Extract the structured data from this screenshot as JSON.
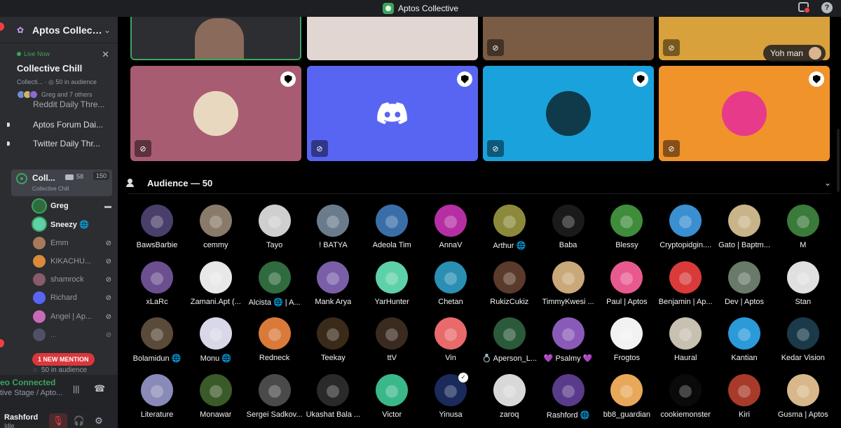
{
  "window": {
    "title": "Aptos Collective"
  },
  "sidebar": {
    "server_name": "Aptos Collecti...",
    "live": {
      "status": "Live Now",
      "title": "Collective Chill",
      "subtitle": "Collecti... · ◎ 50 in audience",
      "people_text": "Greg and 7 others"
    },
    "channels": [
      "Reddit Daily Thre...",
      "Aptos Forum Dai...",
      "Twitter Daily Thr..."
    ],
    "stage": {
      "name": "Coll...",
      "sub": "Collective Chill",
      "video_count": "58",
      "limit": "150"
    },
    "members": [
      {
        "name": "Greg",
        "state": "camera"
      },
      {
        "name": "Sneezy 🌐",
        "state": "none"
      },
      {
        "name": "Emm",
        "state": "muted"
      },
      {
        "name": "KIKACHU...",
        "state": "muted"
      },
      {
        "name": "shamrock",
        "state": "muted"
      },
      {
        "name": "Richard",
        "state": "muted"
      },
      {
        "name": "Angel | Ap...",
        "state": "muted"
      },
      {
        "name": "...",
        "state": "muted"
      }
    ],
    "mention_badge": "1 NEW MENTION",
    "audience_count": "50 in audience",
    "voice": {
      "status": "eo Connected",
      "channel": "tive Stage / Apto..."
    },
    "user": {
      "name": "Rashford",
      "status": "Idle"
    }
  },
  "stage_tiles": {
    "bottom_row_colors": [
      "#a85c72",
      "#5865f2",
      "#1aa2dc",
      "#f0932b"
    ],
    "top_row_colors": [
      "#2d2e31",
      "#e2d6d2",
      "#7a5c45",
      "#d9a13b"
    ],
    "speaker_tag": "Yoh man"
  },
  "audience": {
    "title": "Audience — 50",
    "people": [
      {
        "name": "BawsBarbie",
        "color": "#4a3f6b"
      },
      {
        "name": "cemmy",
        "color": "#8a7a6a"
      },
      {
        "name": "Tayo",
        "color": "#cfcfcf"
      },
      {
        "name": "! BATYA",
        "color": "#6a7c8c"
      },
      {
        "name": "Adeola Tim",
        "color": "#3a6ea8"
      },
      {
        "name": "AnnaV",
        "color": "#b52fa3"
      },
      {
        "name": "Arthur 🌐",
        "color": "#8b8a3c"
      },
      {
        "name": "Baba",
        "color": "#1a1a1a"
      },
      {
        "name": "Blessy",
        "color": "#3f8d3a"
      },
      {
        "name": "Cryptopidgin....",
        "color": "#3a8fd1"
      },
      {
        "name": "Gato | Baptm...",
        "color": "#c9b48a"
      },
      {
        "name": "M",
        "color": "#3a7a3a"
      },
      {
        "name": "xLaRc",
        "color": "#6b4f8f"
      },
      {
        "name": "Zamani.Apt (...",
        "color": "#e8e8e8"
      },
      {
        "name": "Alcista 🌐 | A...",
        "color": "#2f6b3f"
      },
      {
        "name": "Mank Arya",
        "color": "#7a5fa8"
      },
      {
        "name": "YarHunter",
        "color": "#5fd1a8"
      },
      {
        "name": "Chetan",
        "color": "#2a8fb3"
      },
      {
        "name": "RukizCukiz",
        "color": "#5a3a2a"
      },
      {
        "name": "TimmyKwesi ...",
        "color": "#c9a87a"
      },
      {
        "name": "Paul | Aptos",
        "color": "#e85a8f"
      },
      {
        "name": "Benjamin | Ap...",
        "color": "#d93a3a"
      },
      {
        "name": "Dev | Aptos",
        "color": "#6a7a6a"
      },
      {
        "name": "Stan",
        "color": "#e0e0e0"
      },
      {
        "name": "Bolamidun 🌐",
        "color": "#5a4a3a"
      },
      {
        "name": "Monu 🌐",
        "color": "#d8d8e8"
      },
      {
        "name": "Redneck",
        "color": "#d97a3a"
      },
      {
        "name": "Teekay",
        "color": "#3a2a1a"
      },
      {
        "name": "ttV",
        "color": "#3a2a1f"
      },
      {
        "name": "Vin",
        "color": "#e86a6a"
      },
      {
        "name": "💍 Aperson_L...",
        "color": "#2a5a3a"
      },
      {
        "name": "💜 Psalmy 💜",
        "color": "#8a5ab8"
      },
      {
        "name": "Frogtos",
        "color": "#f2f2f2"
      },
      {
        "name": "Haural",
        "color": "#c8c0b0"
      },
      {
        "name": "Kantian",
        "color": "#2a9ad9"
      },
      {
        "name": "Kedar Vision",
        "color": "#1a3a4a"
      },
      {
        "name": "Literature",
        "color": "#8a8ab8"
      },
      {
        "name": "Monawar",
        "color": "#3a5a2a"
      },
      {
        "name": "Sergei Sadkov...",
        "color": "#4a4a4a"
      },
      {
        "name": "Ukashat Bala ...",
        "color": "#2a2a2a"
      },
      {
        "name": "Victor",
        "color": "#3ab88a"
      },
      {
        "name": "Yinusa",
        "color": "#1a2a5a"
      },
      {
        "name": "zaroq",
        "color": "#d8d8d8"
      },
      {
        "name": "Rashford 🌐",
        "color": "#5a3a8a"
      },
      {
        "name": "bb8_guardian",
        "color": "#e8a85a"
      },
      {
        "name": "cookiemonster",
        "color": "#0a0a0a"
      },
      {
        "name": "Kiri",
        "color": "#a83a2a"
      },
      {
        "name": "Gusma | Aptos",
        "color": "#d8b88a"
      }
    ]
  }
}
